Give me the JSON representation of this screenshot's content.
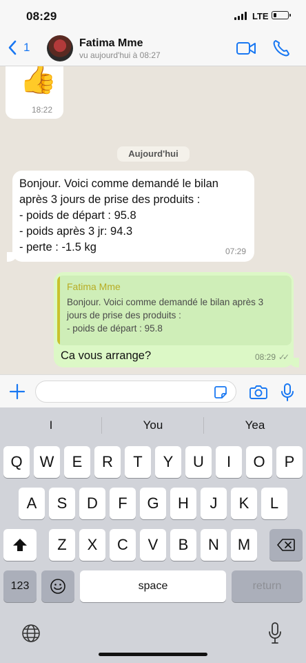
{
  "status_bar": {
    "time": "08:29",
    "network": "LTE"
  },
  "header": {
    "back_count": "1",
    "contact_name": "Fatima Mme",
    "contact_status": "vu aujourd'hui à 08:27"
  },
  "chat": {
    "sticker": {
      "emoji": "👍",
      "time": "18:22"
    },
    "date_label": "Aujourd'hui",
    "incoming": {
      "text": "Bonjour. Voici comme demandé le bilan\naprès 3 jours de prise des produits :\n- poids de départ : 95.8\n- poids après 3 jr:  94.3\n- perte : -1.5 kg",
      "time": "07:29"
    },
    "outgoing": {
      "quote_author": "Fatima Mme",
      "quote_text": "Bonjour. Voici comme demandé le bilan après 3\njours de prise des produits :\n- poids de départ : 95.8",
      "text": "Ca vous arrange?",
      "time": "08:29",
      "ticks": "✓✓"
    }
  },
  "input": {
    "placeholder": ""
  },
  "keyboard": {
    "suggestions": [
      "I",
      "You",
      "Yea"
    ],
    "row1": [
      "Q",
      "W",
      "E",
      "R",
      "T",
      "Y",
      "U",
      "I",
      "O",
      "P"
    ],
    "row2": [
      "A",
      "S",
      "D",
      "F",
      "G",
      "H",
      "J",
      "K",
      "L"
    ],
    "row3": [
      "Z",
      "X",
      "C",
      "V",
      "B",
      "N",
      "M"
    ],
    "numbers_key": "123",
    "space_key": "space",
    "return_key": "return"
  },
  "colors": {
    "accent": "#1877f2",
    "outgoing_bubble": "#dcf8c6",
    "quote_author": "#b7ac24"
  }
}
